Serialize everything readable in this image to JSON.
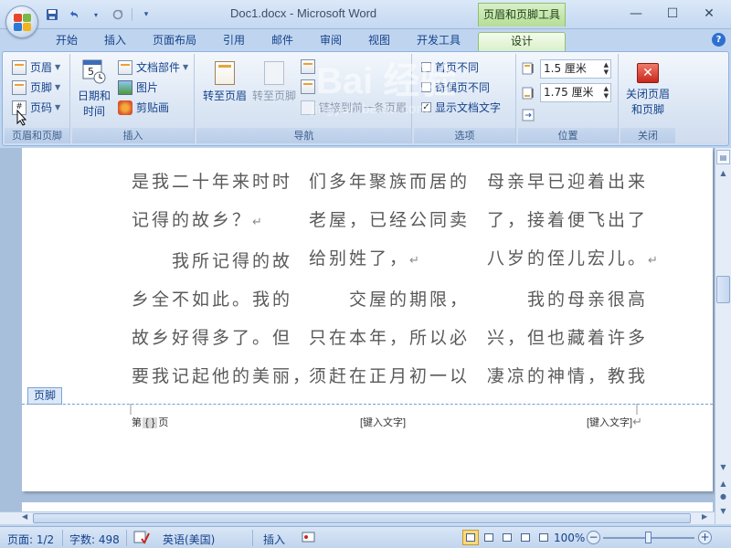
{
  "window": {
    "title": "Doc1.docx - Microsoft Word",
    "contextual_tools_title": "页眉和页脚工具",
    "controls": [
      "minimize-icon",
      "maximize-icon",
      "close-icon"
    ]
  },
  "qat": {
    "items": [
      "save-icon",
      "undo-icon",
      "redo-icon",
      "customize-icon"
    ]
  },
  "tabs": [
    {
      "label": "开始"
    },
    {
      "label": "插入"
    },
    {
      "label": "页面布局"
    },
    {
      "label": "引用"
    },
    {
      "label": "邮件"
    },
    {
      "label": "审阅"
    },
    {
      "label": "视图"
    },
    {
      "label": "开发工具"
    },
    {
      "label": "设计"
    }
  ],
  "ribbon": {
    "header_footer": {
      "header": "页眉",
      "footer": "页脚",
      "page_number": "页码",
      "group_label": "页眉和页脚"
    },
    "insert": {
      "date_time_line1": "日期和",
      "date_time_line2": "时间",
      "doc_parts": "文档部件",
      "picture": "图片",
      "clip_art": "剪贴画",
      "group_label": "插入"
    },
    "navigation": {
      "goto_header": "转至页眉",
      "goto_footer": "转至页脚",
      "link_previous": "链接到前一条页眉",
      "group_label": "导航"
    },
    "options": {
      "different_first": "首页不同",
      "different_odd_even": "奇偶页不同",
      "show_doc_text": "显示文档文字",
      "group_label": "选项"
    },
    "position": {
      "header_pos": "1.5 厘米",
      "footer_pos": "1.75 厘米",
      "group_label": "位置"
    },
    "close": {
      "close_line1": "关闭页眉",
      "close_line2": "和页脚",
      "group_label": "关闭"
    }
  },
  "document": {
    "columns": [
      {
        "lines": [
          "是我二十年来时时",
          "记得的故乡？",
          "　　我所记得的故",
          "乡全不如此。我的",
          "故乡好得多了。但",
          "要我记起他的美丽，"
        ]
      },
      {
        "lines": [
          "们多年聚族而居的",
          "老屋，已经公同卖",
          "给别姓了，",
          "　　交屋的期限，",
          "只在本年，所以必",
          "须赶在正月初一以"
        ]
      },
      {
        "lines": [
          "母亲早已迎着出来",
          "了，接着便飞出了",
          "八岁的侄儿宏儿。",
          "　　我的母亲很高",
          "兴，但也藏着许多",
          "凄凉的神情，教我"
        ]
      }
    ],
    "para_mark": "↵",
    "footer_tag": "页脚",
    "footer": {
      "left_prefix": "第",
      "left_field": "{ }",
      "left_suffix": "页",
      "center": "[键入文字]",
      "right": "[键入文字]"
    }
  },
  "status": {
    "page": "页面: 1/2",
    "words": "字数: 498",
    "language": "英语(美国)",
    "mode": "插入",
    "zoom": "100%"
  },
  "watermark": {
    "logo": "Bai 经验",
    "url": "jingyan.baidu.com"
  }
}
